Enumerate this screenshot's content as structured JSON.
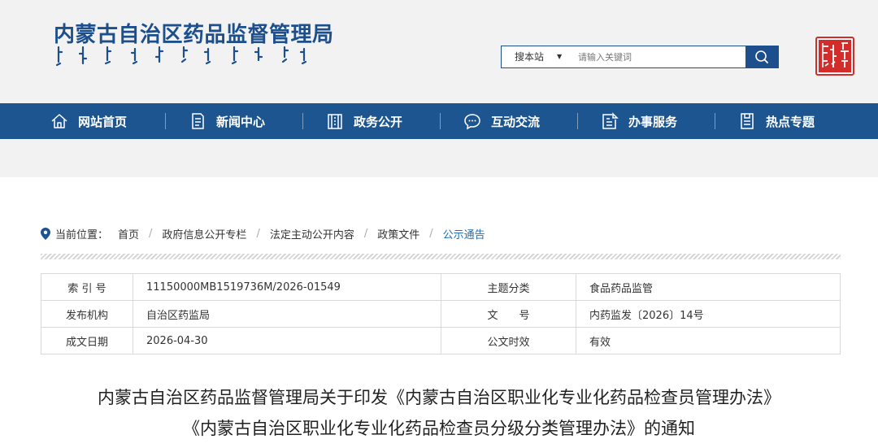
{
  "header": {
    "site_title": "内蒙古自治区药品监督管理局",
    "search_scope": "搜本站",
    "search_placeholder": "请输入关键词",
    "seal_text": "内蒙古"
  },
  "nav": [
    {
      "label": "网站首页",
      "icon": "home-icon"
    },
    {
      "label": "新闻中心",
      "icon": "news-icon"
    },
    {
      "label": "政务公开",
      "icon": "building-icon"
    },
    {
      "label": "互动交流",
      "icon": "chat-icon"
    },
    {
      "label": "办事服务",
      "icon": "edit-icon"
    },
    {
      "label": "热点专题",
      "icon": "document-icon"
    }
  ],
  "breadcrumb": {
    "label": "当前位置：",
    "items": [
      "首页",
      "政府信息公开专栏",
      "法定主动公开内容",
      "政策文件",
      "公示通告"
    ]
  },
  "info": {
    "index_label": "索 引 号",
    "index_value": "11150000MB1519736M/2026-01549",
    "topic_label": "主题分类",
    "topic_value": "食品药品监管",
    "org_label": "发布机构",
    "org_value": "自治区药监局",
    "docno_label": "文　　号",
    "docno_value": "内药监发〔2026〕14号",
    "date_label": "成文日期",
    "date_value": "2026-04-30",
    "status_label": "公文时效",
    "status_value": "有效"
  },
  "title": {
    "line1": "内蒙古自治区药品监督管理局关于印发《内蒙古自治区职业化专业化药品检查员管理办法》",
    "line2": "《内蒙古自治区职业化专业化药品检查员分级分类管理办法》的通知"
  },
  "colors": {
    "primary": "#1c5590",
    "title_blue": "#1c4f8c",
    "seal_red": "#d42b2b",
    "link_blue": "#1c6fb8"
  }
}
